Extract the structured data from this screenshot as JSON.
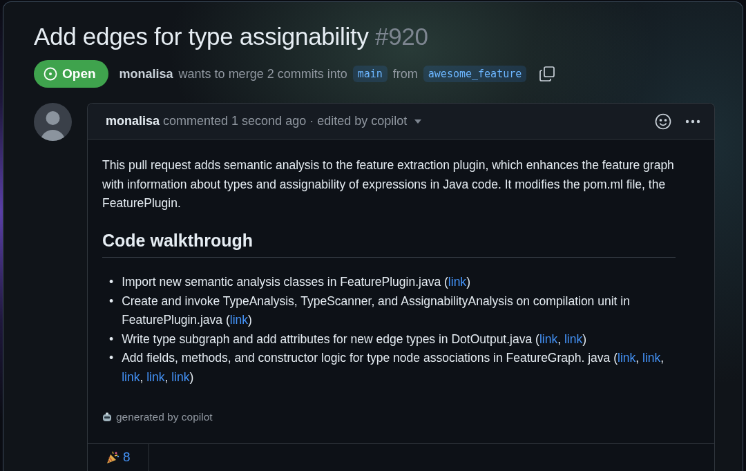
{
  "title": {
    "text": "Add edges for type assignability",
    "number": "#920"
  },
  "state": {
    "label": "Open",
    "kind": "open"
  },
  "merge_info": {
    "author": "monalisa",
    "text": "wants to merge 2 commits into",
    "base": "main",
    "between": "from",
    "head": "awesome_feature"
  },
  "comment": {
    "header": "**monalisa** commented 1 second ago · edited by copilot",
    "body": "This pull request adds semantic analysis to the feature extraction plugin, which enhances the feature graph with information about types and assignability of expressions in Java code. It modifies the pom.ml file, the FeaturePlugin.",
    "heading": "Code walkthrough",
    "bullets": [
      {
        "marker": "•",
        "parts": [
          {
            "kind": "text",
            "text": "Import new semantic analysis classes in FeaturePlugin.java ("
          },
          {
            "kind": "link",
            "text": "link"
          },
          {
            "kind": "text",
            "text": ")"
          }
        ]
      },
      {
        "marker": "•",
        "parts": [
          {
            "kind": "text",
            "text": "Create and invoke TypeAnalysis, TypeScanner, and AssignabilityAnalysis on compilation unit in FeaturePlugin.java ("
          },
          {
            "kind": "link",
            "text": "link"
          },
          {
            "kind": "text",
            "text": ")"
          }
        ]
      },
      {
        "marker": "•",
        "parts": [
          {
            "kind": "text",
            "text": "Write type subgraph and add attributes for new edge types in DotOutput.java ("
          },
          {
            "kind": "link",
            "text": "link"
          },
          {
            "kind": "text",
            "text": ", "
          },
          {
            "kind": "link",
            "text": "link"
          },
          {
            "kind": "text",
            "text": ")"
          }
        ]
      },
      {
        "marker": "•",
        "parts": [
          {
            "kind": "text",
            "text": "Add fields, methods, and constructor logic for type node associations in FeatureGraph. java ("
          },
          {
            "kind": "link",
            "text": "link"
          },
          {
            "kind": "text",
            "text": ", "
          },
          {
            "kind": "link",
            "text": "link"
          },
          {
            "kind": "text",
            "text": ", "
          },
          {
            "kind": "link",
            "text": "link"
          },
          {
            "kind": "text",
            "text": ", "
          },
          {
            "kind": "link",
            "text": "link"
          },
          {
            "kind": "text",
            "text": ", "
          },
          {
            "kind": "link",
            "text": "link"
          },
          {
            "kind": "text",
            "text": ")"
          }
        ]
      }
    ],
    "footer": "generated by copilot",
    "reactions": [
      {
        "count": "8"
      }
    ]
  }
}
